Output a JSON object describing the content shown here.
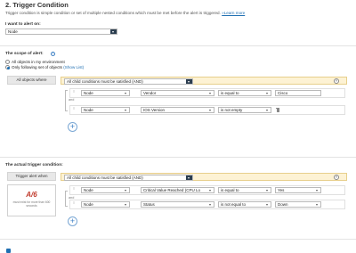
{
  "header": {
    "title": "2. Trigger Condition",
    "subtitle": "Trigger condition is simple condition or set of multiple nested conditions which must be met before the alert is triggered.",
    "learn_more": "»Learn more"
  },
  "alert_on": {
    "label": "I want to alert on:",
    "value": "Node"
  },
  "scope": {
    "label": "The scope of alert:",
    "options": [
      "All objects in my environment",
      "Only following set of objects"
    ],
    "selected_index": 1,
    "show_list": "(Show List)",
    "left_label": "All objects where",
    "group_condition": "All child conditions must be satisfied (AND)",
    "rows": [
      {
        "object": "Node",
        "field": "Vendor",
        "operator": "is equal to",
        "value": "Cisco"
      },
      {
        "object": "Node",
        "field": "IOS Version",
        "operator": "is not empty",
        "value": ""
      }
    ],
    "and_label": "and"
  },
  "trigger": {
    "label": "The actual trigger condition:",
    "left_label": "Trigger alert when",
    "group_condition": "All child conditions must be satisfied (AND)",
    "rows": [
      {
        "object": "Node",
        "field": "Critical Value Reached (CPU Lo",
        "operator": "is equal to",
        "value": "Yes"
      },
      {
        "object": "Node",
        "field": "Status",
        "operator": "is not equal to",
        "value": "Down"
      }
    ],
    "and_label": "and",
    "logo_text": "A/6",
    "logo_caption": "must exist for more than 600 seconds"
  },
  "icons": {
    "info": "info-icon",
    "remove": "remove-circle-icon",
    "add": "add-circle-icon",
    "trash": "trash-icon",
    "grip": "drag-handle-icon",
    "caret": "chevron-down-icon"
  },
  "colors": {
    "accent": "#1f6fb2",
    "condition_bar": "#fdf2d4",
    "dropdown_caret": "#2c3e50"
  }
}
